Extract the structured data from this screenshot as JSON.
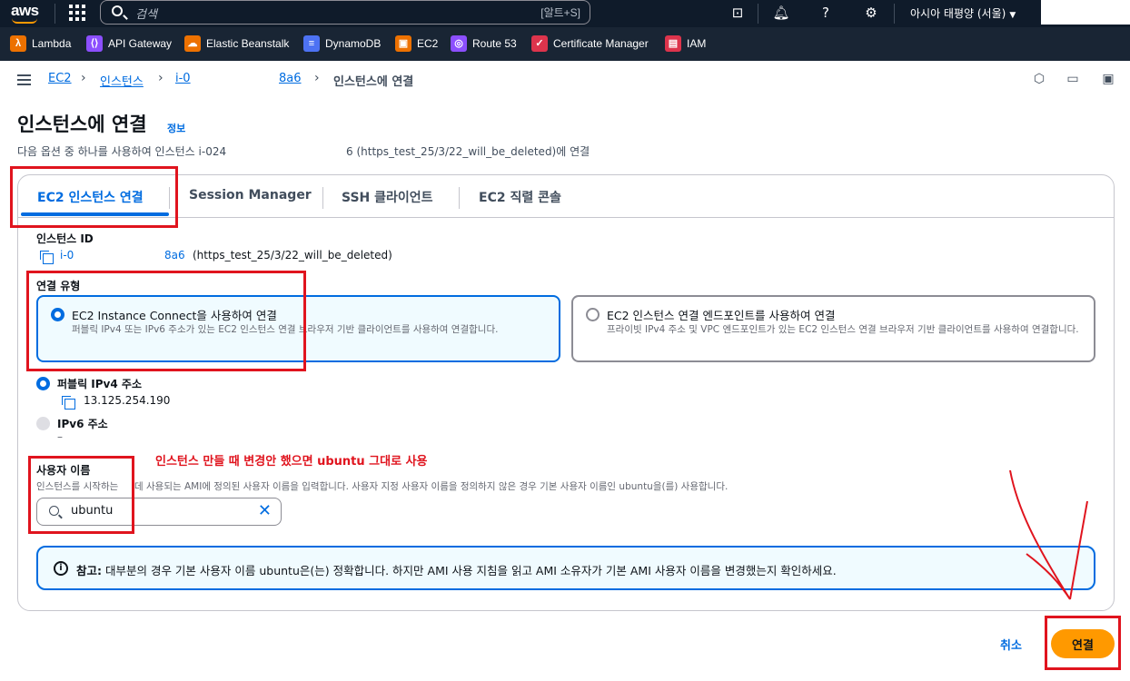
{
  "topbar": {
    "logo": "aws",
    "search_placeholder": "검색",
    "search_shortcut": "[알트+S]",
    "icons": [
      "cloudshell-icon",
      "bell-icon",
      "help-icon",
      "gear-icon"
    ],
    "region": "아시아 태평양 (서울)"
  },
  "favorites": [
    {
      "label": "Lambda",
      "color": "#ed7100",
      "glyph": "λ"
    },
    {
      "label": "API Gateway",
      "color": "#8c4fff",
      "glyph": "⟨⟩"
    },
    {
      "label": "Elastic Beanstalk",
      "color": "#ed7100",
      "glyph": "☁"
    },
    {
      "label": "DynamoDB",
      "color": "#4d72f3",
      "glyph": "≡"
    },
    {
      "label": "EC2",
      "color": "#ed7100",
      "glyph": "▣"
    },
    {
      "label": "Route 53",
      "color": "#8c4fff",
      "glyph": "◎"
    },
    {
      "label": "Certificate Manager",
      "color": "#dd344c",
      "glyph": "✓"
    },
    {
      "label": "IAM",
      "color": "#dd344c",
      "glyph": "▤"
    }
  ],
  "breadcrumb": {
    "items": [
      "EC2",
      "인스턴스",
      "i-0",
      "8a6"
    ],
    "current": "인스턴스에 연결"
  },
  "page": {
    "title": "인스턴스에 연결",
    "info": "정보",
    "description_a": "다음 옵션 중 하나를 사용하여 인스턴스 i-024",
    "description_b": "6 (https_test_25/3/22_will_be_deleted)에 연결"
  },
  "tabs": [
    "EC2 인스턴스 연결",
    "Session Manager",
    "SSH 클라이언트",
    "EC2 직렬 콘솔"
  ],
  "instance": {
    "label": "인스턴스 ID",
    "id_a": "i-0",
    "id_b": "8a6",
    "name": "(https_test_25/3/22_will_be_deleted)"
  },
  "connection": {
    "label": "연결 유형",
    "option1_title": "EC2 Instance Connect을 사용하여 연결",
    "option1_desc": "퍼블릭 IPv4 또는 IPv6 주소가 있는 EC2 인스턴스 연결 브라우저 기반 클라이언트를 사용하여 연결합니다.",
    "option2_title": "EC2 인스턴스 연결 엔드포인트를 사용하여 연결",
    "option2_desc": "프라이빗 IPv4 주소 및 VPC 엔드포인트가 있는 EC2 인스턴스 연결 브라우저 기반 클라이언트를 사용하여 연결합니다."
  },
  "address": {
    "ipv4_label": "퍼블릭 IPv4 주소",
    "ipv4_value": "13.125.254.190",
    "ipv6_label": "IPv6 주소",
    "ipv6_value": "–"
  },
  "username": {
    "label": "사용자 이름",
    "desc_a": "인스턴스를 시작하는",
    "desc_b": "데 사용되는 AMI에 정의된 사용자 이름을 입력합니다. 사용자 지정 사용자 이름을 정의하지 않은 경우 기본 사용자 이름인 ubuntu을(를) 사용합니다.",
    "value": "ubuntu"
  },
  "alert": {
    "bold": "참고:",
    "text": " 대부분의 경우 기본 사용자 이름 ubuntu은(는) 정확합니다. 하지만 AMI 사용 지침을 읽고 AMI 소유자가 기본 AMI 사용자 이름을 변경했는지 확인하세요."
  },
  "actions": {
    "cancel": "취소",
    "connect": "연결"
  },
  "annotation": "인스턴스 만들 때 변경안 했으면 ubuntu 그대로 사용",
  "colors": {
    "primary": "#006ce0",
    "connect": "#ff9900",
    "annotation": "#e0141e",
    "nav": "#0f1b2a"
  }
}
